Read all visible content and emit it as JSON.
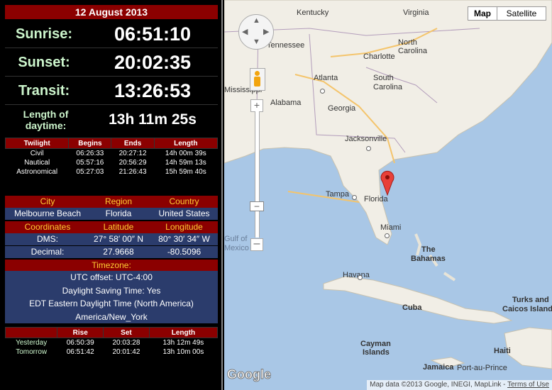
{
  "date": "12 August 2013",
  "sun": {
    "sunrise": {
      "label": "Sunrise:",
      "value": "06:51:10"
    },
    "sunset": {
      "label": "Sunset:",
      "value": "20:02:35"
    },
    "transit": {
      "label": "Transit:",
      "value": "13:26:53"
    },
    "length": {
      "label_line1": "Length of",
      "label_line2": "daytime:",
      "value": "13h 11m 25s"
    }
  },
  "twilight": {
    "headers": [
      "Twilight",
      "Begins",
      "Ends",
      "Length"
    ],
    "rows": [
      [
        "Civil",
        "06:26:33",
        "20:27:12",
        "14h 00m 39s"
      ],
      [
        "Nautical",
        "05:57:16",
        "20:56:29",
        "14h 59m 13s"
      ],
      [
        "Astronomical",
        "05:27:03",
        "21:26:43",
        "15h 59m 40s"
      ]
    ]
  },
  "location": {
    "headers": [
      "City",
      "Region",
      "Country"
    ],
    "values": [
      "Melbourne Beach",
      "Florida",
      "United States"
    ],
    "coord_headers": [
      "Coordinates",
      "Latitude",
      "Longitude"
    ],
    "dms": [
      "DMS:",
      "27° 58′ 00″ N",
      "80° 30′ 34″ W"
    ],
    "decimal": [
      "Decimal:",
      "27.9668",
      "-80.5096"
    ]
  },
  "timezone": {
    "header": "Timezone:",
    "lines": [
      "UTC offset: UTC-4:00",
      "Daylight Saving Time: Yes",
      "EDT Eastern Daylight Time (North America)",
      "America/New_York"
    ]
  },
  "rise_set": {
    "headers": [
      "",
      "Rise",
      "Set",
      "Length"
    ],
    "rows": [
      [
        "Yesterday",
        "06:50:39",
        "20:03:28",
        "13h 12m 49s"
      ],
      [
        "Tomorrow",
        "06:51:42",
        "20:01:42",
        "13h 10m 00s"
      ]
    ]
  },
  "map": {
    "map_button": "Map",
    "satellite_button": "Satellite",
    "labels": {
      "kentucky": "Kentucky",
      "virginia": "Virginia",
      "tennessee": "Tennessee",
      "charlotte": "Charlotte",
      "north_carolina": "North Carolina",
      "mississippi": "Mississippi",
      "atlanta": "Atlanta",
      "south_carolina": "South Carolina",
      "alabama": "Alabama",
      "georgia": "Georgia",
      "jacksonville": "Jacksonville",
      "tampa": "Tampa",
      "florida": "Florida",
      "gulf_line1": "Gulf of",
      "gulf_line2": "Mexico",
      "miami": "Miami",
      "bahamas_line1": "The",
      "bahamas_line2": "Bahamas",
      "havana": "Havana",
      "cuba": "Cuba",
      "turks_line1": "Turks and",
      "turks_line2": "Caicos Islands",
      "cayman_line1": "Cayman",
      "cayman_line2": "Islands",
      "haiti": "Haiti",
      "jamaica": "Jamaica",
      "port_au_prince": "Port-au-Prince",
      "google": "Google"
    },
    "attribution": "Map data ©2013 Google, INEGI, MapLink - ",
    "terms": "Terms of Use",
    "colors": {
      "water": "#a9c7e6",
      "land": "#f1eee6",
      "marker": "#e8403a"
    }
  }
}
